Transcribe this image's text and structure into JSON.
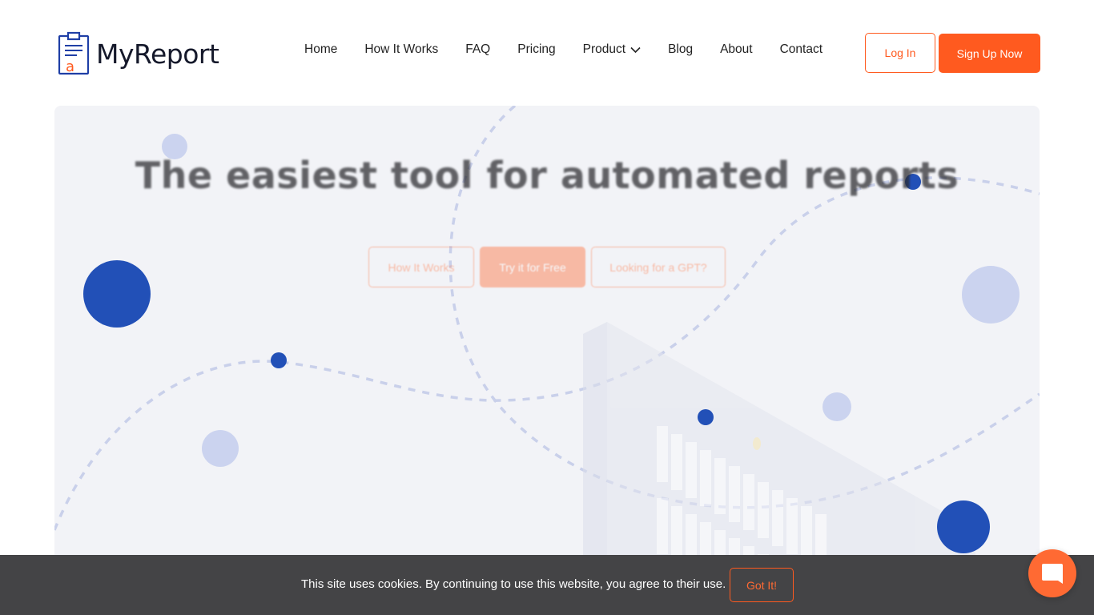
{
  "brand": {
    "name": "MyReport",
    "accent": "#ff5a1f",
    "logo_icon": "clipboard-report-icon"
  },
  "nav": {
    "items": [
      {
        "label": "Home"
      },
      {
        "label": "How It Works"
      },
      {
        "label": "FAQ"
      },
      {
        "label": "Pricing"
      },
      {
        "label": "Product",
        "icon": "chevron-down-icon"
      },
      {
        "label": "Blog"
      },
      {
        "label": "About"
      },
      {
        "label": "Contact"
      }
    ],
    "login_label": "Log In",
    "signup_label": "Sign Up Now"
  },
  "hero": {
    "title": "The easiest tool for automated reports",
    "buttons": {
      "how_it_works": "How It Works",
      "try_free": "Try it for Free",
      "gpt": "Looking for a GPT?"
    }
  },
  "cookie": {
    "message": "This site uses cookies. By continuing to use this website, you agree to their use.",
    "button": "Got It!"
  },
  "chat": {
    "icon": "chat-bubble-icon"
  }
}
